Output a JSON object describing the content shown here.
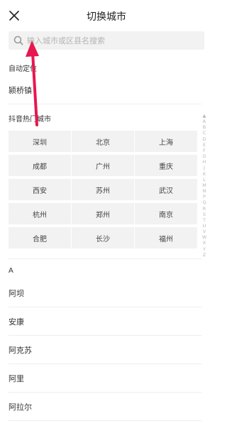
{
  "header": {
    "title": "切换城市",
    "close_icon": "close-icon"
  },
  "search": {
    "placeholder": "输入城市或区县名搜索",
    "icon": "search-icon"
  },
  "auto_location": {
    "label": "自动定位",
    "city": "颍桥镇"
  },
  "hot_cities": {
    "label": "抖音热门城市",
    "cities": [
      "深圳",
      "北京",
      "上海",
      "成都",
      "广州",
      "重庆",
      "西安",
      "苏州",
      "武汉",
      "杭州",
      "郑州",
      "南京",
      "合肥",
      "长沙",
      "福州"
    ]
  },
  "city_list": {
    "letter": "A",
    "cities": [
      "阿坝",
      "安康",
      "阿克苏",
      "阿里",
      "阿拉尔"
    ]
  },
  "index_bar": [
    "▲",
    "A",
    "B",
    "C",
    "D",
    "E",
    "F",
    "G",
    "H",
    "J",
    "K",
    "L",
    "M",
    "N",
    "P",
    "Q",
    "R",
    "S",
    "T",
    "U",
    "V",
    "W",
    "X",
    "Y",
    "Z"
  ],
  "colors": {
    "arrow": "#e8174f",
    "cell_bg": "#f2f2f2",
    "divider": "#eeeeee"
  }
}
